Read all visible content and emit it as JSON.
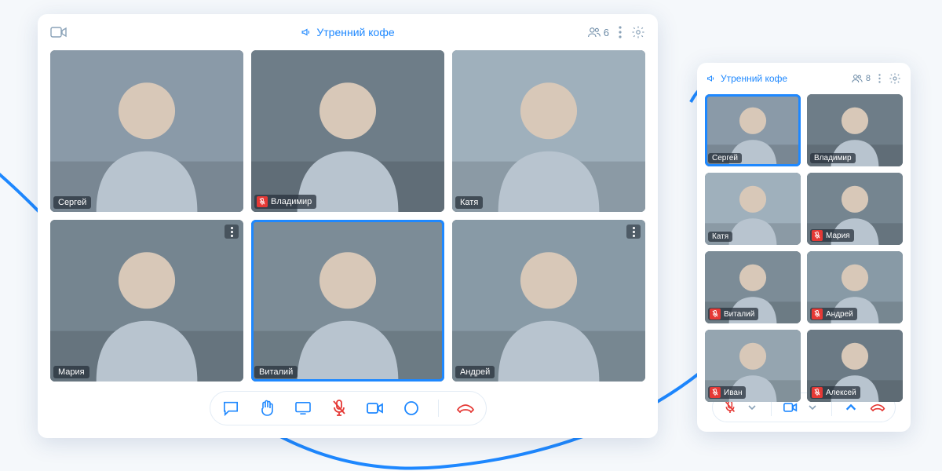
{
  "desktop": {
    "room_title": "Утренний кофе",
    "participant_count": "6",
    "tiles": [
      {
        "name": "Сергей",
        "muted": false,
        "active": false,
        "menu": false
      },
      {
        "name": "Владимир",
        "muted": true,
        "active": false,
        "menu": false
      },
      {
        "name": "Катя",
        "muted": false,
        "active": false,
        "menu": false
      },
      {
        "name": "Мария",
        "muted": false,
        "active": false,
        "menu": true
      },
      {
        "name": "Виталий",
        "muted": false,
        "active": true,
        "menu": false
      },
      {
        "name": "Андрей",
        "muted": false,
        "active": false,
        "menu": true
      }
    ]
  },
  "mobile": {
    "room_title": "Утренний кофе",
    "participant_count": "8",
    "tiles": [
      {
        "name": "Сергей",
        "muted": false,
        "active": true
      },
      {
        "name": "Владимир",
        "muted": false,
        "active": false
      },
      {
        "name": "Катя",
        "muted": false,
        "active": false
      },
      {
        "name": "Мария",
        "muted": true,
        "active": false
      },
      {
        "name": "Виталий",
        "muted": true,
        "active": false
      },
      {
        "name": "Андрей",
        "muted": true,
        "active": false
      },
      {
        "name": "Иван",
        "muted": true,
        "active": false
      },
      {
        "name": "Алексей",
        "muted": true,
        "active": false
      }
    ]
  },
  "colors": {
    "accent": "#1e88ff",
    "danger": "#e53935"
  }
}
